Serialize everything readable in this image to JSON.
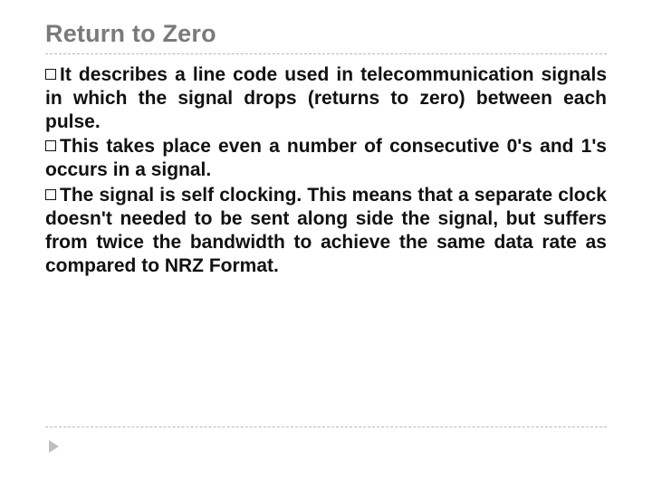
{
  "title": "Return to Zero",
  "bullets": [
    "It describes a line code used in telecommunication signals in which the signal drops (returns to zero) between each pulse.",
    "This takes place even a number of consecutive 0's and 1's occurs in a signal.",
    "The signal is self clocking. This means that a separate clock doesn't needed to be sent along side the signal, but suffers from twice the bandwidth to achieve the same data rate as compared to NRZ Format."
  ]
}
